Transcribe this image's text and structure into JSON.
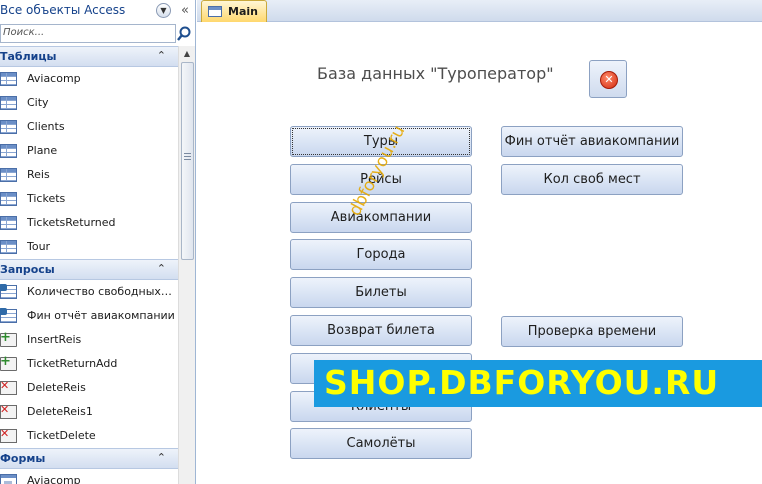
{
  "nav": {
    "title": "Все объекты Access",
    "dropdown_icon": "chevron-down-icon",
    "collapse_icon": "«",
    "search_placeholder": "Поиск...",
    "groups": [
      {
        "title": "Таблицы",
        "items": [
          {
            "label": "Aviacomp",
            "icon": "table-icon"
          },
          {
            "label": "City",
            "icon": "table-icon"
          },
          {
            "label": "Clients",
            "icon": "table-icon"
          },
          {
            "label": "Plane",
            "icon": "table-icon"
          },
          {
            "label": "Reis",
            "icon": "table-icon"
          },
          {
            "label": "Tickets",
            "icon": "table-icon"
          },
          {
            "label": "TicketsReturned",
            "icon": "table-icon"
          },
          {
            "label": "Tour",
            "icon": "table-icon"
          }
        ]
      },
      {
        "title": "Запросы",
        "items": [
          {
            "label": "Количество свободных м...",
            "icon": "select-query-icon"
          },
          {
            "label": "Фин отчёт авиакомпании",
            "icon": "select-query-icon"
          },
          {
            "label": "InsertReis",
            "icon": "append-query-icon"
          },
          {
            "label": "TicketReturnAdd",
            "icon": "append-query-icon"
          },
          {
            "label": "DeleteReis",
            "icon": "delete-query-icon"
          },
          {
            "label": "DeleteReis1",
            "icon": "delete-query-icon"
          },
          {
            "label": "TicketDelete",
            "icon": "delete-query-icon"
          }
        ]
      },
      {
        "title": "Формы",
        "items": [
          {
            "label": "Aviacomp",
            "icon": "form-icon"
          }
        ]
      }
    ]
  },
  "tab": {
    "label": "Main"
  },
  "form": {
    "title": "База данных \"Туроператор\"",
    "buttons_left": [
      "Туры",
      "Рейсы",
      "Авиакомпании",
      "Города",
      "Билеты",
      "Возврат билета",
      "В",
      "Клиенты",
      "Самолёты"
    ],
    "buttons_right": [
      "Фин отчёт авиакомпании",
      "Кол своб мест",
      "Проверка времени"
    ]
  },
  "watermarks": {
    "diagonal": "dbforyou.ru",
    "banner": "SHOP.DBFORYOU.RU"
  },
  "colors": {
    "banner_bg": "#1a9ae0",
    "banner_text": "#ffff00",
    "group_title": "#15428b"
  }
}
